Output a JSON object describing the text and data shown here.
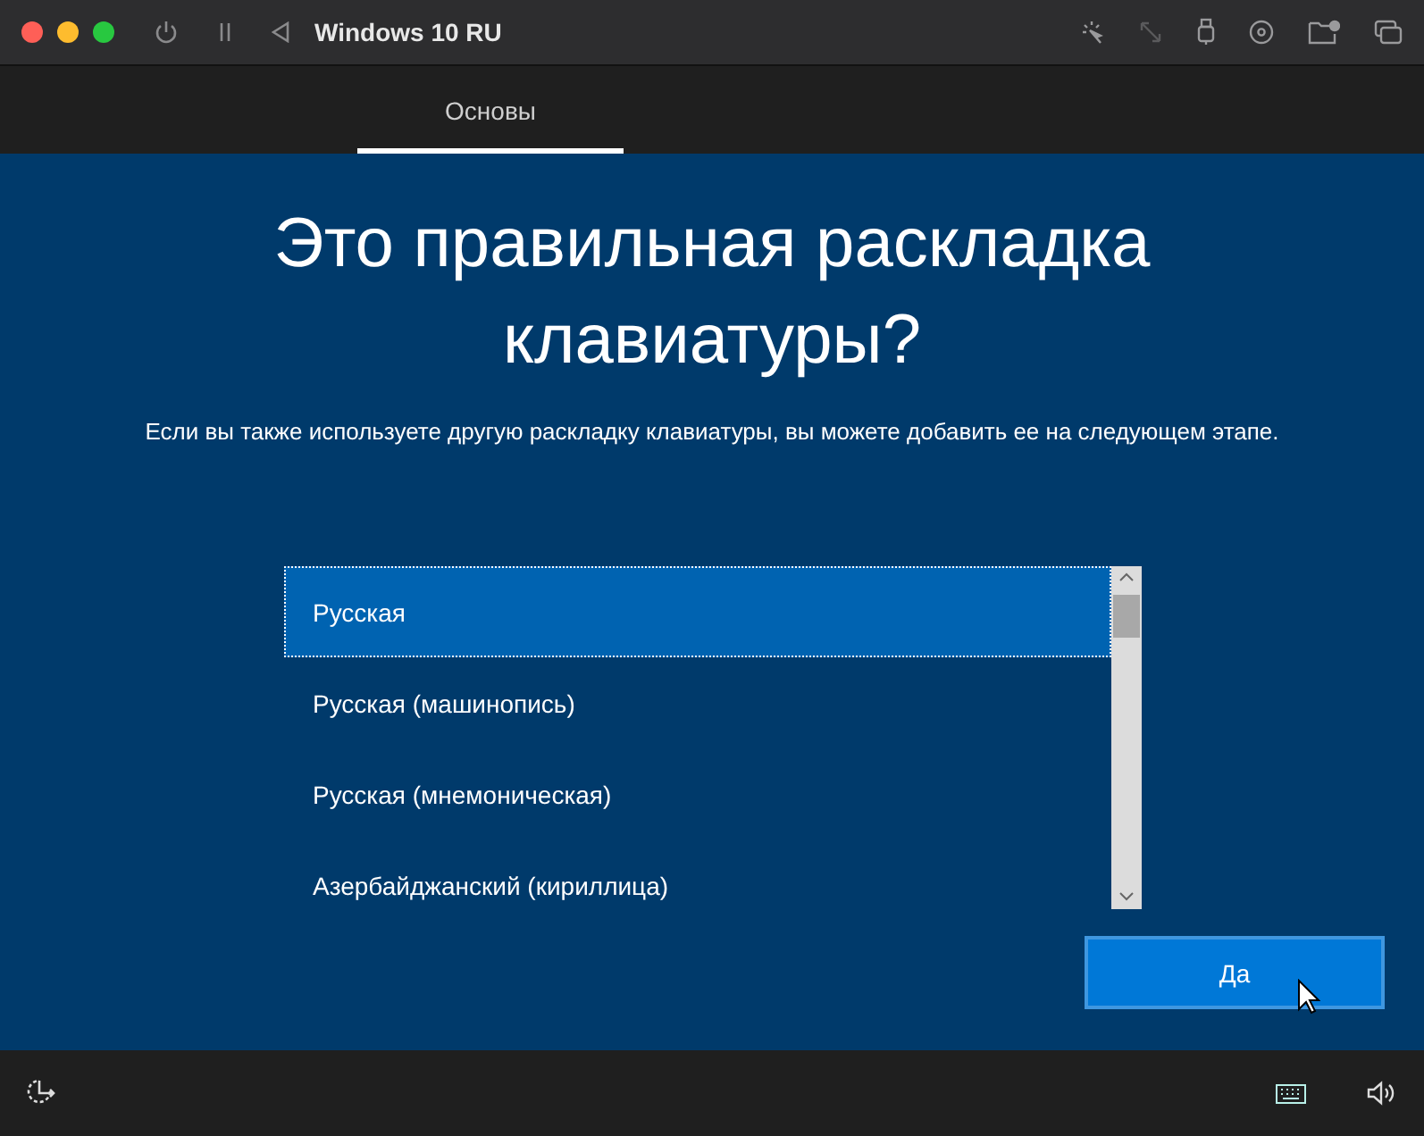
{
  "window": {
    "title": "Windows 10 RU"
  },
  "tabs": [
    {
      "label": "Основы",
      "selected": true
    }
  ],
  "heading": "Это правильная раскладка клавиатуры?",
  "subtitle": "Если вы также используете другую раскладку клавиатуры, вы можете добавить ее на следующем этапе.",
  "layouts": [
    {
      "label": "Русская",
      "selected": true
    },
    {
      "label": "Русская (машинопись)",
      "selected": false
    },
    {
      "label": "Русская (мнемоническая)",
      "selected": false
    },
    {
      "label": "Азербайджанский (кириллица)",
      "selected": false
    }
  ],
  "buttons": [
    {
      "label": "Да"
    }
  ]
}
